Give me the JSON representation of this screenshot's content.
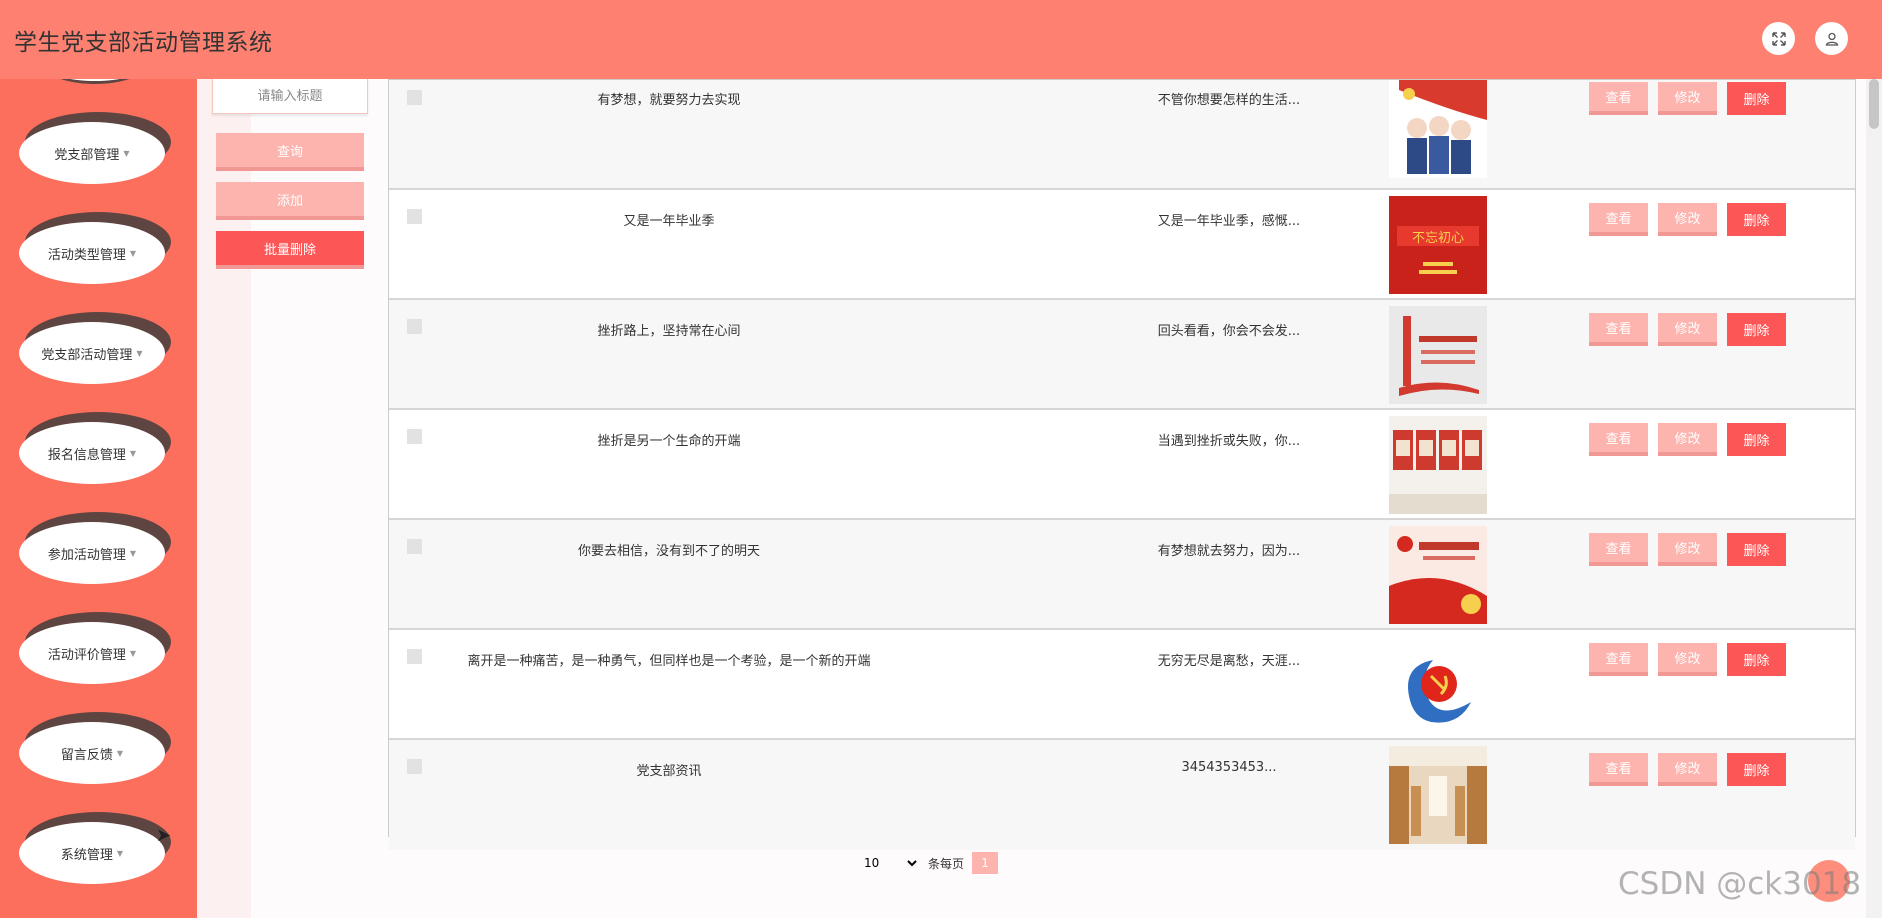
{
  "header": {
    "title": "学生党支部活动管理系统"
  },
  "icons": {
    "fullscreen": "fullscreen-icon",
    "user": "user-icon"
  },
  "sidebar": {
    "items": [
      {
        "label": "党支部管理"
      },
      {
        "label": "活动类型管理"
      },
      {
        "label": "党支部活动管理"
      },
      {
        "label": "报名信息管理"
      },
      {
        "label": "参加活动管理"
      },
      {
        "label": "活动评价管理"
      },
      {
        "label": "留言反馈"
      },
      {
        "label": "系统管理"
      }
    ]
  },
  "toolbar": {
    "search_placeholder": "请输入标题",
    "search_label": "查询",
    "add_label": "添加",
    "batch_delete_label": "批量删除"
  },
  "table": {
    "actions": {
      "view": "查看",
      "edit": "修改",
      "delete": "删除"
    },
    "rows": [
      {
        "title": "有梦想，就要努力去实现",
        "desc": "不管你想要怎样的生活..."
      },
      {
        "title": "又是一年毕业季",
        "desc": "又是一年毕业季，感慨..."
      },
      {
        "title": "挫折路上，坚持常在心间",
        "desc": "回头看看，你会不会发..."
      },
      {
        "title": "挫折是另一个生命的开端",
        "desc": "当遇到挫折或失败，你..."
      },
      {
        "title": "你要去相信，没有到不了的明天",
        "desc": "有梦想就去努力，因为..."
      },
      {
        "title": "离开是一种痛苦，是一种勇气，但同样也是一个考验，是一个新的开端",
        "desc": "无穷无尽是离愁，天涯..."
      },
      {
        "title": "党支部资讯",
        "desc": "3454353453..."
      }
    ]
  },
  "pagination": {
    "page_size": "10",
    "per_page_label": "条每页",
    "current_page": "1"
  },
  "watermark": "CSDN @ck3018",
  "colors": {
    "header": "#fd8070",
    "sidebar": "#fd6f5d",
    "light_button": "#fdb3ae",
    "danger_button": "#fd5656"
  }
}
